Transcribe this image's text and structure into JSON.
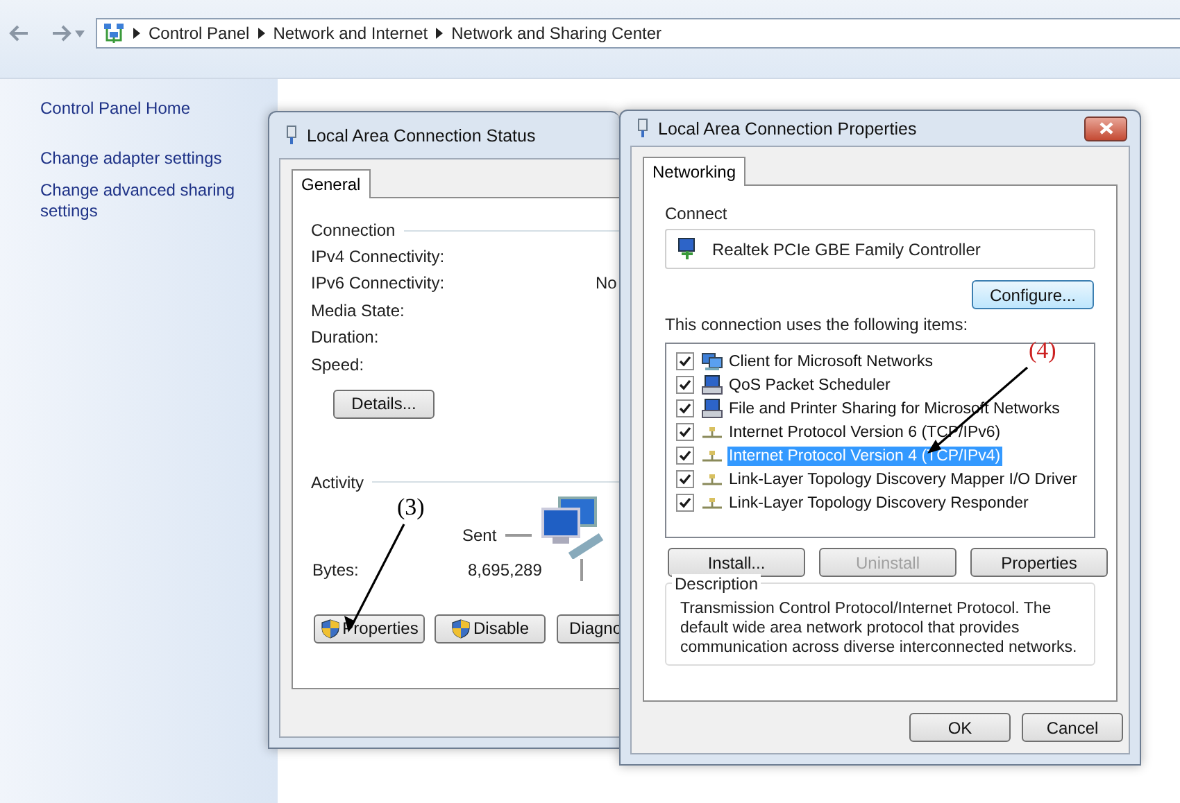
{
  "address_bar": {
    "breadcrumbs": [
      "Control Panel",
      "Network and Internet",
      "Network and Sharing Center"
    ]
  },
  "sidebar": {
    "links": [
      "Control Panel Home",
      "Change adapter settings",
      "Change advanced sharing settings"
    ]
  },
  "status_window": {
    "title": "Local Area Connection Status",
    "tabs": [
      {
        "label": "General",
        "selected": true
      }
    ],
    "connection_group": "Connection",
    "fields": [
      {
        "label": "IPv4 Connectivity:"
      },
      {
        "label": "IPv6 Connectivity:",
        "value": "No"
      },
      {
        "label": "Media State:"
      },
      {
        "label": "Duration:"
      },
      {
        "label": "Speed:"
      }
    ],
    "details_button": "Details...",
    "activity_group": "Activity",
    "sent_label": "Sent",
    "bytes_label": "Bytes:",
    "bytes_sent": "8,695,289",
    "buttons": [
      {
        "label": "Properties",
        "shield": true
      },
      {
        "label": "Disable",
        "shield": true
      },
      {
        "label": "Diagno",
        "shield": false
      }
    ]
  },
  "properties_window": {
    "title": "Local Area Connection Properties",
    "tabs": [
      {
        "label": "Networking",
        "selected": true
      }
    ],
    "connect_label": "Connect",
    "adapter": "Realtek PCIe GBE Family Controller",
    "configure_button": "Configure...",
    "items_label": "This connection uses the following items:",
    "items": [
      {
        "label": "Client for Microsoft Networks",
        "checked": true,
        "selected": false,
        "kind": "client"
      },
      {
        "label": "QoS Packet Scheduler",
        "checked": true,
        "selected": false,
        "kind": "service"
      },
      {
        "label": "File and Printer Sharing for Microsoft Networks",
        "checked": true,
        "selected": false,
        "kind": "service"
      },
      {
        "label": "Internet Protocol Version 6 (TCP/IPv6)",
        "checked": true,
        "selected": false,
        "kind": "protocol"
      },
      {
        "label": "Internet Protocol Version 4 (TCP/IPv4)",
        "checked": true,
        "selected": true,
        "kind": "protocol"
      },
      {
        "label": "Link-Layer Topology Discovery Mapper I/O Driver",
        "checked": true,
        "selected": false,
        "kind": "protocol"
      },
      {
        "label": "Link-Layer Topology Discovery Responder",
        "checked": true,
        "selected": false,
        "kind": "protocol"
      }
    ],
    "buttons": [
      {
        "label": "Install...",
        "disabled": false
      },
      {
        "label": "Uninstall",
        "disabled": true
      },
      {
        "label": "Properties",
        "disabled": false
      }
    ],
    "description_group": "Description",
    "description": "Transmission Control Protocol/Internet Protocol. The default wide area network protocol that provides communication across diverse interconnected networks.",
    "footer_buttons": [
      "OK",
      "Cancel"
    ]
  },
  "annotations": [
    {
      "label": "(3)",
      "color": "#000000"
    },
    {
      "label": "(4)",
      "color": "#cc2222"
    }
  ]
}
